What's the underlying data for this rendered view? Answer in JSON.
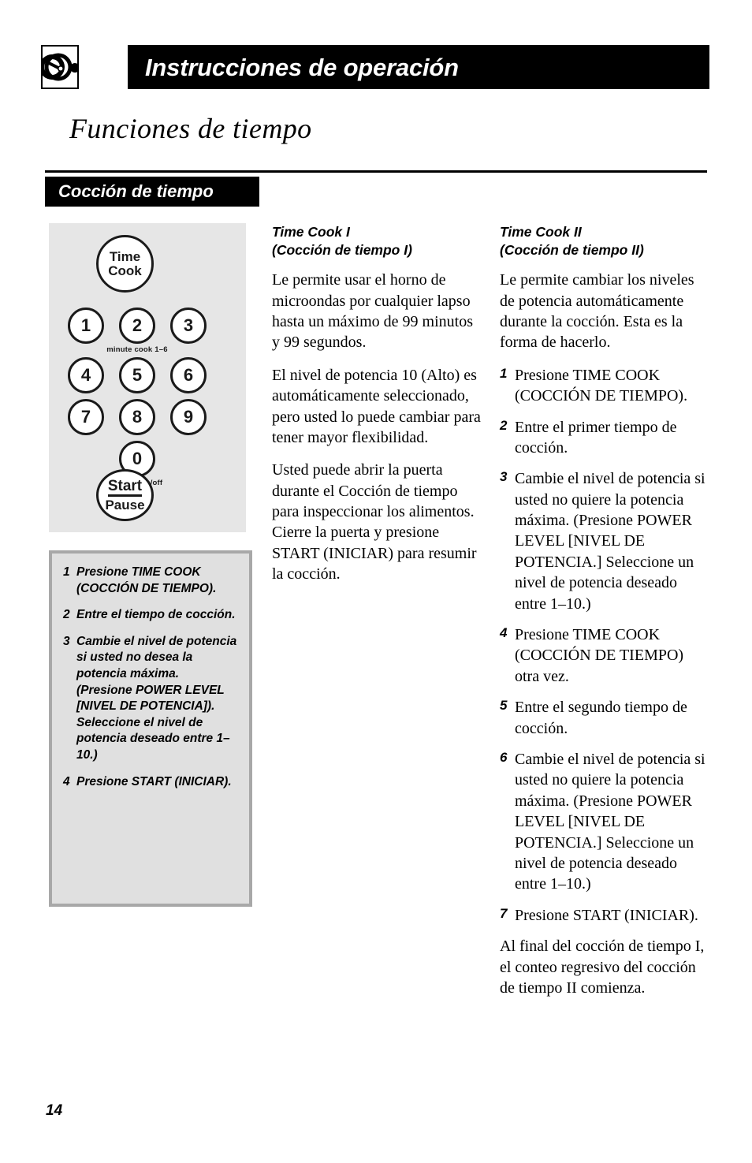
{
  "header": {
    "icon_name": "dial-knob-icon",
    "title": "Instrucciones de operación"
  },
  "chapter_title": "Funciones de tiempo",
  "section_banner": "Cocción de tiempo",
  "keypad": {
    "time_cook_line1": "Time",
    "time_cook_line2": "Cook",
    "numbers": [
      "1",
      "2",
      "3",
      "4",
      "5",
      "6",
      "7",
      "8",
      "9",
      "0"
    ],
    "minute_cook_label": "minute cook 1–6",
    "display_label": "display on/off",
    "start_label": "Start",
    "pause_label": "Pause"
  },
  "steps_box": {
    "steps": [
      {
        "num": "1",
        "text": "Presione TIME COOK (COCCIÓN DE TIEMPO)."
      },
      {
        "num": "2",
        "text": "Entre el tiempo de cocción."
      },
      {
        "num": "3",
        "text": "Cambie el nivel de potencia si usted no desea la potencia máxima. (Presione POWER LEVEL [NIVEL DE POTENCIA]). Seleccione el nivel de potencia deseado entre 1–10.)"
      },
      {
        "num": "4",
        "text": "Presione START (INICIAR)."
      }
    ]
  },
  "column_middle": {
    "subhead_line1": "Time Cook I",
    "subhead_line2": "(Cocción de tiempo I)",
    "paragraphs": [
      "Le permite usar el horno de microondas por cualquier lapso hasta un máximo de 99 minutos y 99 segundos.",
      "El nivel de potencia 10 (Alto) es automáticamente seleccionado, pero usted lo puede cambiar para tener mayor flexibilidad.",
      "Usted puede abrir la puerta durante el Cocción de tiempo para inspeccionar los alimentos. Cierre la puerta y presione START (INICIAR) para resumir la cocción."
    ]
  },
  "column_right": {
    "subhead_line1": "Time Cook II",
    "subhead_line2": "(Cocción de tiempo II)",
    "intro": "Le permite cambiar los niveles de potencia automáticamente durante la cocción. Esta es la forma de hacerlo.",
    "steps": [
      {
        "num": "1",
        "text": "Presione TIME COOK (COCCIÓN DE TIEMPO)."
      },
      {
        "num": "2",
        "text": "Entre el primer tiempo de cocción."
      },
      {
        "num": "3",
        "text": "Cambie el nivel de potencia si usted no quiere la potencia máxima. (Presione POWER LEVEL [NIVEL DE POTENCIA.] Seleccione un nivel de potencia deseado entre 1–10.)"
      },
      {
        "num": "4",
        "text": "Presione TIME COOK (COCCIÓN DE TIEMPO) otra vez."
      },
      {
        "num": "5",
        "text": "Entre el segundo tiempo de cocción."
      },
      {
        "num": "6",
        "text": "Cambie el nivel de potencia si usted no quiere la potencia máxima. (Presione POWER LEVEL [NIVEL DE POTENCIA.] Seleccione un nivel de potencia deseado entre 1–10.)"
      },
      {
        "num": "7",
        "text": "Presione START (INICIAR)."
      }
    ],
    "closing": "Al final del cocción de tiempo I, el conteo regresivo del cocción de tiempo II comienza."
  },
  "page_number": "14"
}
